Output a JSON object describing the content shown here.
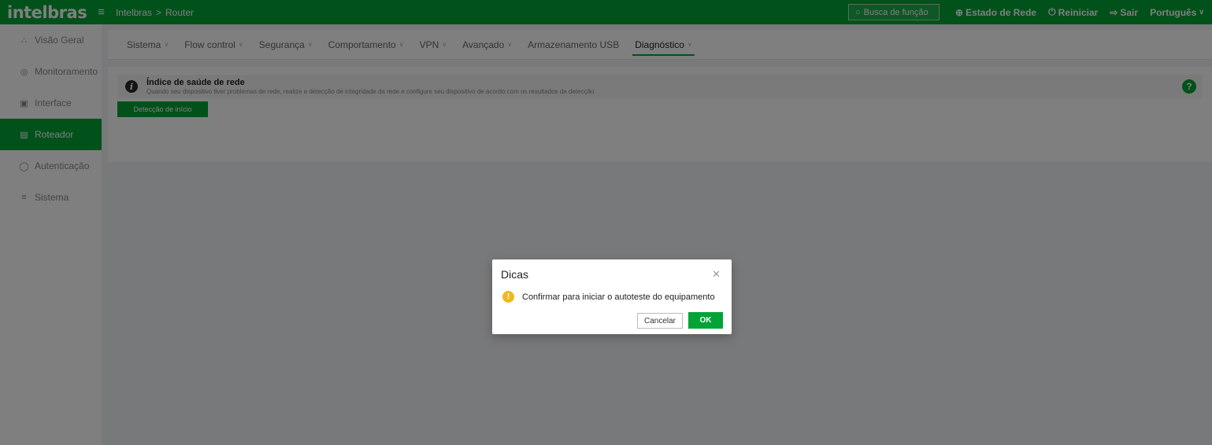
{
  "header": {
    "logo": "intelbras",
    "menu_icon": "hamburger-icon",
    "breadcrumb": [
      "Intelbras",
      "Router"
    ],
    "search_placeholder": "Busca de função",
    "network_status": "Estado de Rede",
    "restart": "Reiniciar",
    "logout": "Sair",
    "language": "Português"
  },
  "sidebar": {
    "items": [
      {
        "label": "Visão Geral",
        "icon": "network-topology-icon"
      },
      {
        "label": "Monitoramento",
        "icon": "monitor-icon"
      },
      {
        "label": "Interface",
        "icon": "interface-icon"
      },
      {
        "label": "Roteador",
        "icon": "router-icon"
      },
      {
        "label": "Autenticação",
        "icon": "shield-icon"
      },
      {
        "label": "Sistema",
        "icon": "settings-sliders-icon"
      }
    ]
  },
  "tabs": [
    {
      "label": "Sistema"
    },
    {
      "label": "Flow control"
    },
    {
      "label": "Segurança"
    },
    {
      "label": "Comportamento"
    },
    {
      "label": "VPN"
    },
    {
      "label": "Avançado"
    },
    {
      "label": "Armazenamento USB"
    },
    {
      "label": "Diagnóstico"
    }
  ],
  "panel": {
    "info_title": "Índice de saúde de rede",
    "info_text": "Quando seu dispositivo tiver problemas de rede, realize a detecção de integridade da rede e configure seu dispositivo de acordo com os resultados da detecção",
    "start_button": "Detecção de início"
  },
  "dialog": {
    "title": "Dicas",
    "message": "Confirmar para iniciar o autoteste do equipamento",
    "cancel": "Cancelar",
    "ok": "OK"
  },
  "colors": {
    "brand": "#00a335",
    "warning": "#f0b820"
  }
}
